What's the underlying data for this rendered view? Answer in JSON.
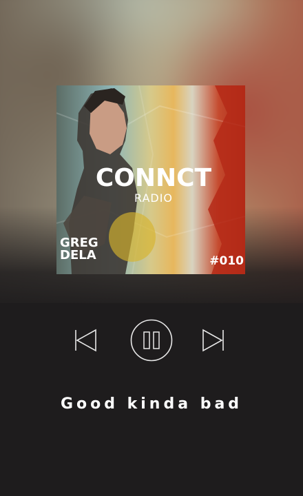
{
  "album": {
    "brand": "CONNCT",
    "subtitle": "RADIO",
    "artist_line1": "GREG",
    "artist_line2": "DELA",
    "episode": "#010"
  },
  "controls": {
    "previous_icon": "skip-previous-icon",
    "play_pause_icon": "pause-icon",
    "next_icon": "skip-next-icon",
    "state": "playing"
  },
  "track": {
    "title": "Good kinda bad"
  },
  "colors": {
    "background": "#1e1c1d",
    "icon_stroke": "#e8e8e8",
    "title_text": "#ffffff"
  }
}
